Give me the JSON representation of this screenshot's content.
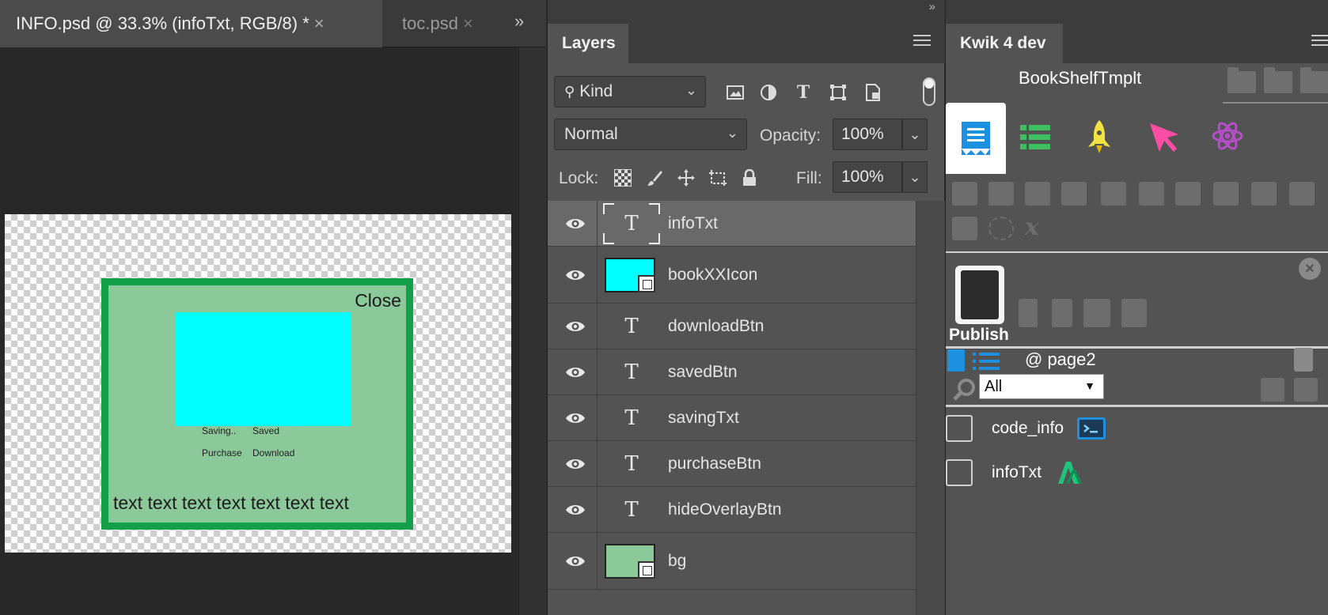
{
  "document": {
    "active_tab": "INFO.psd @ 33.3% (infoTxt, RGB/8) *",
    "active_tab_close": "×",
    "inactive_tab": "toc.psd",
    "inactive_tab_close": "×",
    "overflow": "»",
    "canvas": {
      "close_label": "Close",
      "saving_label": "Saving..",
      "saved_label": "Saved",
      "purchase_label": "Purchase",
      "download_label": "Download",
      "body_text": "text text text text text text text",
      "colors": {
        "frame": "#14a048",
        "fill": "#8cc99a",
        "icon": "#00ffff"
      }
    }
  },
  "layers_panel": {
    "title": "Layers",
    "collapse": "»",
    "filter": {
      "value": "Kind",
      "icons": [
        "image-filter-icon",
        "adjustment-filter-icon",
        "type-filter-icon",
        "shape-filter-icon",
        "smart-object-filter-icon"
      ],
      "type_glyph": "T"
    },
    "blend_mode": "Normal",
    "opacity_label": "Opacity:",
    "opacity_value": "100%",
    "lock_label": "Lock:",
    "fill_label": "Fill:",
    "fill_value": "100%",
    "layers": [
      {
        "name": "infoTxt",
        "kind": "text",
        "selected": true,
        "glyph": "T"
      },
      {
        "name": "bookXXIcon",
        "kind": "image",
        "color": "#00ffff"
      },
      {
        "name": "downloadBtn",
        "kind": "text",
        "glyph": "T"
      },
      {
        "name": "savedBtn",
        "kind": "text",
        "glyph": "T"
      },
      {
        "name": "savingTxt",
        "kind": "text",
        "glyph": "T"
      },
      {
        "name": "purchaseBtn",
        "kind": "text",
        "glyph": "T"
      },
      {
        "name": "hideOverlayBtn",
        "kind": "text",
        "glyph": "T"
      },
      {
        "name": "bg",
        "kind": "image",
        "color": "#8cc99a"
      }
    ]
  },
  "kwik_panel": {
    "title": "Kwik 4 dev",
    "project": "BookShelfTmplt",
    "publish_label": "Publish",
    "close_glyph": "×",
    "page_label": "@ page2",
    "filter_value": "All",
    "filter_arrow": "▼",
    "items": [
      {
        "label": "code_info",
        "icon": "code-icon"
      },
      {
        "label": "infoTxt",
        "icon": "text-type-icon"
      }
    ],
    "accent_colors": {
      "doc": "#1e90e0",
      "list": "#3fbf5f",
      "rocket": "#f1e442",
      "cursor": "#ff4da6",
      "atom": "#b44fc8"
    }
  }
}
